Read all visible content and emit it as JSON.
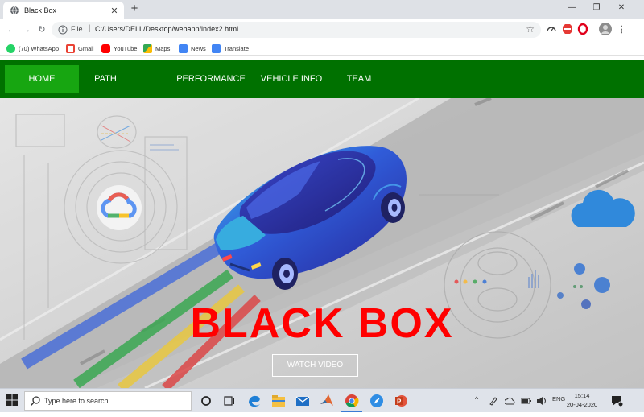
{
  "browser": {
    "tab": {
      "title": "Black Box",
      "close_icon": "close-icon"
    },
    "window_controls": [
      "minimize-icon",
      "maximize-icon",
      "close-icon"
    ],
    "address": {
      "scheme_label": "File",
      "url": "C:/Users/DELL/Desktop/webapp/index2.html"
    },
    "bookmarks": [
      {
        "label": "(70) WhatsApp",
        "icon": "whatsapp-icon",
        "color": "#25d366"
      },
      {
        "label": "Gmail",
        "icon": "gmail-icon",
        "color": "#ea4335"
      },
      {
        "label": "YouTube",
        "icon": "youtube-icon",
        "color": "#ff0000"
      },
      {
        "label": "Maps",
        "icon": "maps-icon",
        "color": "#34a853"
      },
      {
        "label": "News",
        "icon": "news-icon",
        "color": "#4285f4"
      },
      {
        "label": "Translate",
        "icon": "translate-icon",
        "color": "#4285f4"
      }
    ]
  },
  "site": {
    "nav": {
      "items": [
        "HOME",
        "PATH",
        "PERFORMANCE",
        "VEHICLE INFO",
        "TEAM"
      ],
      "active": "HOME",
      "colors": {
        "bar": "#007100",
        "active": "#17a611"
      }
    },
    "hero": {
      "title": "BLACK BOX",
      "title_color": "#ff0000",
      "button_label": "WATCH VIDEO"
    }
  },
  "taskbar": {
    "search_placeholder": "Type here to search",
    "language": "ENG",
    "time": "15:14",
    "date": "20-04-2020",
    "apps": [
      "task-view-icon",
      "edge-icon",
      "file-explorer-icon",
      "mail-icon",
      "matlab-icon",
      "chrome-icon",
      "safari-icon",
      "powerpoint-icon"
    ]
  }
}
